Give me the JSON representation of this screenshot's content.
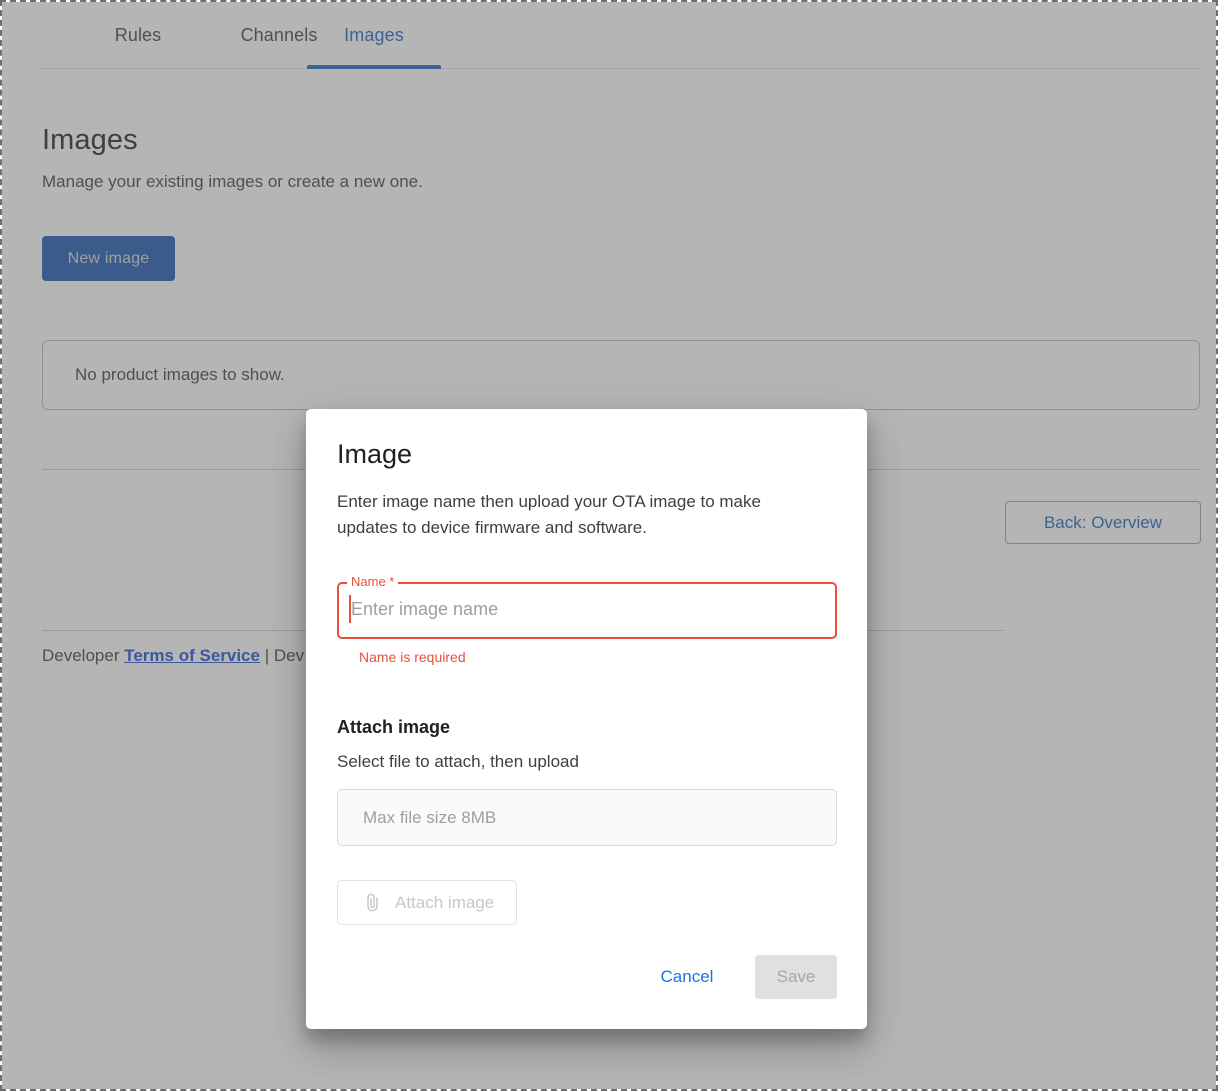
{
  "tabs": [
    {
      "label": "Rules",
      "active": false
    },
    {
      "label": "Channels",
      "active": false
    },
    {
      "label": "Images",
      "active": true
    }
  ],
  "page": {
    "title": "Images",
    "subtitle": "Manage your existing images or create a new one.",
    "new_image_button": "New image",
    "empty_state": "No product images to show.",
    "back_button": "Back: Overview"
  },
  "footer": {
    "prefix": "Developer ",
    "link": "Terms of Service",
    "suffix": " | Dev"
  },
  "dialog": {
    "title": "Image",
    "description": "Enter image name then upload your OTA image to make updates to device firmware and software.",
    "name_field": {
      "label": "Name *",
      "value": "",
      "placeholder": "Enter image name",
      "error": "Name is required"
    },
    "attach": {
      "title": "Attach image",
      "subtitle": "Select file to attach, then upload",
      "file_placeholder": "Max file size 8MB",
      "button_label": "Attach image",
      "button_icon": "paperclip-icon"
    },
    "actions": {
      "cancel": "Cancel",
      "save": "Save"
    }
  },
  "colors": {
    "accent_blue": "#1765c0",
    "primary_button": "#1a56b0",
    "link_blue": "#1a73e8",
    "error_red": "#e8503a",
    "scrim": "rgba(97,97,97,.47)",
    "disabled_gray": "#e0e0e0"
  }
}
